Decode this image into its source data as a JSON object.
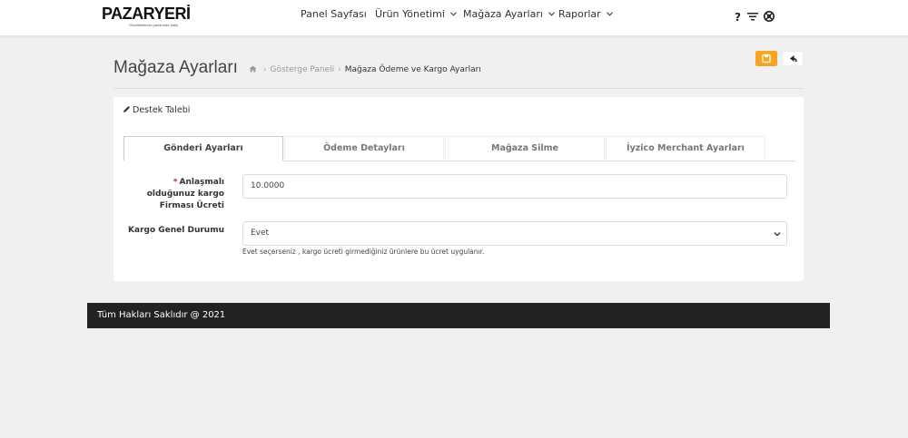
{
  "brand": {
    "name": "PAZARYERİ",
    "tagline": "Güzellikleinize pazarında satış"
  },
  "nav": {
    "items": [
      {
        "label": "Panel Sayfası"
      },
      {
        "label": "Ürün Yönetimi"
      },
      {
        "label": "Mağaza Ayarları"
      },
      {
        "label": "Raporlar"
      }
    ],
    "icons": [
      "help-icon",
      "filter-icon",
      "globe-icon"
    ]
  },
  "page": {
    "title": "Mağaza Ayarları",
    "breadcrumb": {
      "home_icon": "home-icon",
      "level1": "Gösterge Paneli",
      "current": "Mağaza Ödeme ve Kargo Ayarları"
    },
    "save_icon": "save-icon",
    "back_icon": "reply-icon"
  },
  "card": {
    "support_label": "Destek Talebi",
    "support_icon": "pencil-icon",
    "tabs": [
      {
        "label": "Gönderi Ayarları",
        "active": true
      },
      {
        "label": "Ödeme Detayları",
        "active": false
      },
      {
        "label": "Mağaza Silme",
        "active": false
      },
      {
        "label": "İyzico Merchant Ayarları",
        "active": false
      }
    ],
    "form": {
      "cargo_price": {
        "label_required": "*",
        "label_line1": "Anlaşmalı",
        "label_line2": "olduğunuz kargo",
        "label_line3": "Firması Ücreti",
        "value": "10.0000"
      },
      "cargo_status": {
        "label": "Kargo Genel Durumu",
        "value": "Evet",
        "help": "Evet seçerseniz , kargo ücreti girmediğiniz ürünlere bu ücret uygulanır."
      }
    }
  },
  "footer": {
    "text": "Tüm Hakları Saklıdır @ 2021"
  },
  "colors": {
    "accent": "#f5a623",
    "footer": "#222222",
    "background": "#f0f0f0",
    "required": "#d9232d"
  }
}
